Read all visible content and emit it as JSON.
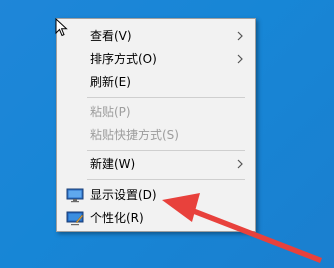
{
  "context_menu": {
    "items": [
      {
        "label": "查看(V)",
        "has_submenu": true,
        "enabled": true
      },
      {
        "label": "排序方式(O)",
        "has_submenu": true,
        "enabled": true
      },
      {
        "label": "刷新(E)",
        "has_submenu": false,
        "enabled": true
      },
      {
        "label": "粘贴(P)",
        "has_submenu": false,
        "enabled": false
      },
      {
        "label": "粘贴快捷方式(S)",
        "has_submenu": false,
        "enabled": false
      },
      {
        "label": "新建(W)",
        "has_submenu": true,
        "enabled": true
      },
      {
        "label": "显示设置(D)",
        "has_submenu": false,
        "enabled": true,
        "icon": "display-settings-icon"
      },
      {
        "label": "个性化(R)",
        "has_submenu": false,
        "enabled": true,
        "icon": "personalize-icon"
      }
    ]
  },
  "colors": {
    "desktop": "#1a84d4",
    "menu_bg": "#f2f2f2",
    "arrow": "#e8413c",
    "disabled_text": "#9d9d9d"
  }
}
